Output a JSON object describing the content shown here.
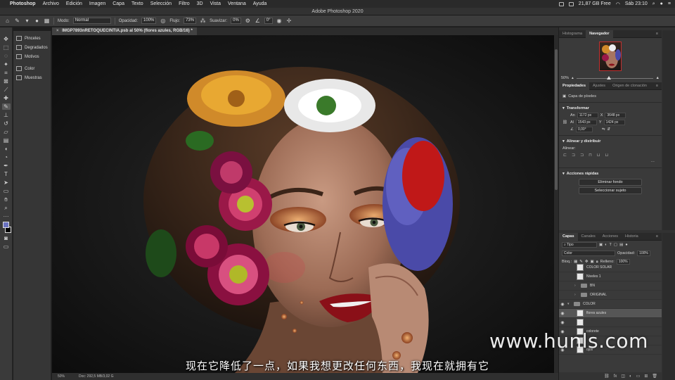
{
  "menubar": {
    "app": "Photoshop",
    "items": [
      "Archivo",
      "Edición",
      "Imagen",
      "Capa",
      "Texto",
      "Selección",
      "Filtro",
      "3D",
      "Vista",
      "Ventana",
      "Ayuda"
    ],
    "storage": "21,87 GB Free",
    "clock": "Sáb 23:10"
  },
  "titlebar": {
    "title": "Adobe Photoshop 2020"
  },
  "options": {
    "mode_label": "Modo:",
    "mode_value": "Normal",
    "opacity_label": "Opacidad:",
    "opacity_value": "100%",
    "flow_label": "Flujo:",
    "flow_value": "73%",
    "smooth_label": "Suavizar:",
    "smooth_value": "0%",
    "angle_value": "0°"
  },
  "tools": [
    "move-icon",
    "marquee-icon",
    "lasso-icon",
    "quick-select-icon",
    "crop-icon",
    "frame-icon",
    "eyedropper-icon",
    "healing-icon",
    "brush-icon",
    "stamp-icon",
    "history-brush-icon",
    "eraser-icon",
    "gradient-icon",
    "blur-icon",
    "dodge-icon",
    "pen-icon",
    "type-icon",
    "path-select-icon",
    "shape-icon",
    "hand-icon",
    "zoom-icon"
  ],
  "libraries": {
    "group1": [
      "Pinceles",
      "Degradados",
      "Motivos"
    ],
    "group2": [
      "Color",
      "Muestras"
    ]
  },
  "document": {
    "tab_title": "IMGP7893nRETOQUECINTIA.psb al 50% (flores azules, RGB/16) *",
    "zoom": "50%",
    "doc_info": "Doc: 292,5 MB/3,02 G"
  },
  "navigator": {
    "tabs": [
      "Histograma",
      "Navegador"
    ],
    "active_tab": "Navegador",
    "zoom": "50%",
    "zoom_fraction": 0.4
  },
  "properties": {
    "tabs": [
      "Propiedades",
      "Ajustes",
      "Origen de clonación"
    ],
    "layer_type": "Capa de píxeles",
    "transform_title": "Transformar",
    "an_label": "An",
    "an_value": "1172 px",
    "x_label": "X",
    "x_value": "3648 px",
    "al_label": "Al",
    "al_value": "1543 px",
    "y_label": "Y",
    "y_value": "1424 px",
    "angle_value": "0,00°",
    "align_title": "Alinear y distribuir",
    "align_label": "Alinear:",
    "quick_title": "Acciones rápidas",
    "btn_remove_bg": "Eliminar fondo",
    "btn_select_subject": "Seleccionar sujeto"
  },
  "layers": {
    "tabs": [
      "Capas",
      "Canales",
      "Acciones",
      "Historia"
    ],
    "filter_kind": "Tipo",
    "blend_mode": "Color",
    "opacity_label": "Opacidad:",
    "opacity_value": "100%",
    "lock_label": "Bloq.:",
    "fill_label": "Relleno:",
    "fill_value": "100%",
    "items": [
      {
        "name": "COLOR SOLAR",
        "kind": "thumb",
        "visible": false,
        "indent": 1
      },
      {
        "name": "Niveles 1",
        "kind": "thumb",
        "visible": false,
        "indent": 1
      },
      {
        "name": "BN",
        "kind": "folder",
        "visible": false,
        "indent": 1
      },
      {
        "name": "ORIGINAL",
        "kind": "folder",
        "visible": false,
        "indent": 1
      },
      {
        "name": "COLOR",
        "kind": "folder",
        "visible": true,
        "indent": 0
      },
      {
        "name": "flores azules",
        "kind": "thumb",
        "visible": true,
        "indent": 1,
        "selected": true
      },
      {
        "name": "",
        "kind": "thumb",
        "visible": true,
        "indent": 1
      },
      {
        "name": "colorete",
        "kind": "thumb",
        "visible": true,
        "indent": 1
      },
      {
        "name": "",
        "kind": "thumb",
        "visible": false,
        "indent": 1
      },
      {
        "name": "ojos",
        "kind": "thumb",
        "visible": true,
        "indent": 1
      }
    ]
  },
  "overlay": {
    "subtitle": "现在它降低了一点，如果我想更改任何东西，我现在就拥有它",
    "watermark": "www.hunls.com"
  }
}
